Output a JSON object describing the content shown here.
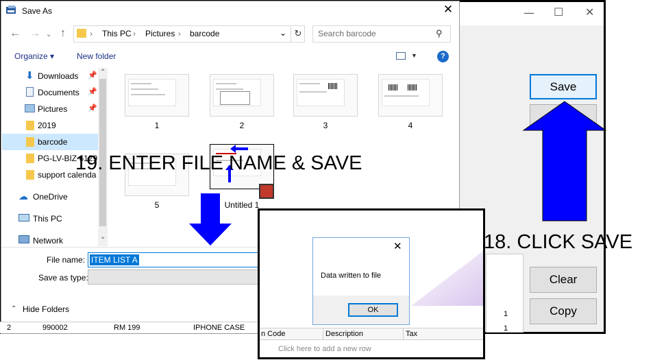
{
  "save_dialog": {
    "title": "Save As",
    "close": "✕",
    "address": [
      "This PC",
      "Pictures",
      "barcode"
    ],
    "search_placeholder": "Search barcode",
    "organize": "Organize ▾",
    "new_folder": "New folder",
    "help": "?",
    "sidebar": [
      {
        "label": "Downloads",
        "icon": "download-icon",
        "pinned": true
      },
      {
        "label": "Documents",
        "icon": "documents-icon",
        "pinned": true
      },
      {
        "label": "Pictures",
        "icon": "pictures-icon",
        "pinned": true
      },
      {
        "label": "2019",
        "icon": "folder-icon"
      },
      {
        "label": "barcode",
        "icon": "folder-icon",
        "selected": true
      },
      {
        "label": "PG-LV-BIZ 6129",
        "icon": "folder-icon"
      },
      {
        "label": "support calenda",
        "icon": "folder-icon"
      },
      {
        "label": "OneDrive",
        "icon": "cloud-icon"
      },
      {
        "label": "This PC",
        "icon": "computer-icon"
      },
      {
        "label": "Network",
        "icon": "network-icon"
      }
    ],
    "files": [
      "1",
      "2",
      "3",
      "4",
      "5",
      "Untitled 1"
    ],
    "file_name_label": "File name:",
    "file_name_value": "ITEM LIST A",
    "save_as_type_label": "Save as type:",
    "hide_folders": "Hide Folders",
    "footer_row": {
      "idx": "2",
      "code": "990002",
      "price": "RM 199",
      "desc": "IPHONE CASE"
    }
  },
  "background_app": {
    "minimize": "—",
    "maximize": "☐",
    "close": "✕",
    "buttons": {
      "save": "Save",
      "clear": "Clear",
      "copy": "Copy"
    },
    "list_values": [
      "1",
      "1"
    ]
  },
  "overlay_window": {
    "columns": [
      "n Code",
      "Description",
      "Tax"
    ],
    "new_row": "Click here to add a new row"
  },
  "data_dialog": {
    "message": "Data written to file",
    "ok": "OK",
    "close": "✕"
  },
  "annotations": {
    "step19": "19. ENTER FILE NAME & SAVE",
    "step18": "18. CLICK SAVE",
    "arrow_color": "#0000ff"
  }
}
